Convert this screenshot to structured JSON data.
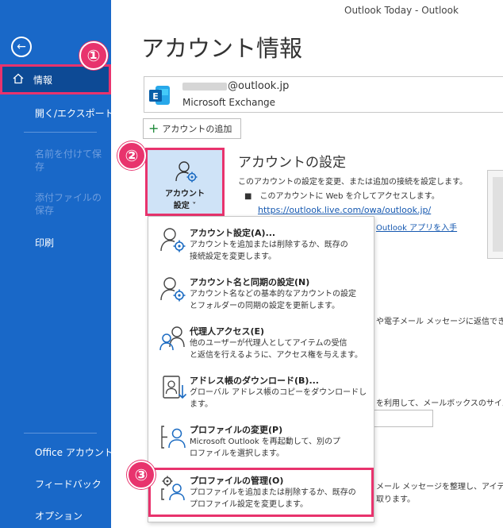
{
  "window": {
    "title": "Outlook Today  -  Outlook"
  },
  "sidebar": {
    "back": "←",
    "items": [
      {
        "label": "情報"
      },
      {
        "label": "開く/エクスポート"
      },
      {
        "label": "名前を付けて保存"
      },
      {
        "label": "添付ファイルの保存"
      },
      {
        "label": "印刷"
      },
      {
        "label": "Office アカウント"
      },
      {
        "label": "フィードバック"
      },
      {
        "label": "オプション"
      }
    ]
  },
  "badges": {
    "b1": "①",
    "b2": "②",
    "b3": "③"
  },
  "main": {
    "title": "アカウント情報",
    "account": {
      "email": "@outlook.jp",
      "type": "Microsoft Exchange"
    },
    "add_account": "アカウントの追加",
    "settings_tile": {
      "line1": "アカウント",
      "line2": "設定 ˅"
    },
    "section": {
      "title": "アカウントの設定",
      "desc": "このアカウントの設定を変更、または追加の接続を設定します。",
      "bullet": "■　このアカウントに Web を介してアクセスします。",
      "link": "https://outlook.live.com/owa/outlook.jp/",
      "link2": "Outlook アプリを入手"
    },
    "bg_texts": {
      "reply": "や電子メール メッセージに返信でき",
      "mailbox": "を利用して、メールボックスのサイズ",
      "organize": "メール メッセージを整理し、アイテム",
      "received": "取ります。"
    }
  },
  "menu": {
    "items": [
      {
        "title": "アカウント設定(A)...",
        "desc1": "アカウントを追加または削除するか、既存の",
        "desc2": "接続設定を変更します。"
      },
      {
        "title": "アカウント名と同期の設定(N)",
        "desc1": "アカウント名などの基本的なアカウントの設定",
        "desc2": "とフォルダーの同期の設定を更新します。"
      },
      {
        "title": "代理人アクセス(E)",
        "desc1": "他のユーザーが代理人としてアイテムの受信",
        "desc2": "と返信を行えるように、アクセス権を与えます。"
      },
      {
        "title": "アドレス帳のダウンロード(B)...",
        "desc1": "グローバル アドレス帳のコピーをダウンロードし",
        "desc2": "ます。"
      },
      {
        "title": "プロファイルの変更(P)",
        "desc1": "Microsoft Outlook を再起動して、別のプ",
        "desc2": "ロファイルを選択します。"
      },
      {
        "title": "プロファイルの管理(O)",
        "desc1": "プロファイルを追加または削除するか、既存の",
        "desc2": "プロファイル設定を変更します。"
      }
    ]
  },
  "colors": {
    "sidebar": "#1968c8",
    "sidebar_active": "#0d4a95",
    "highlight": "#e8336d",
    "tile": "#cfe3f7",
    "link": "#1558b0"
  }
}
